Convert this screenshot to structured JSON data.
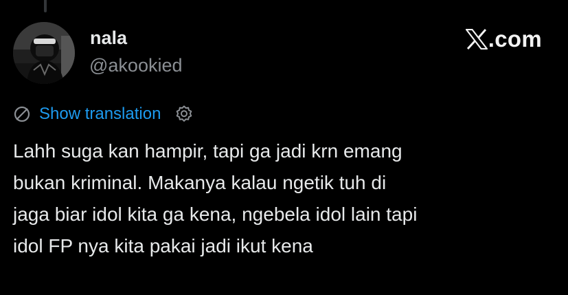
{
  "author": {
    "display_name": "nala",
    "handle": "@akookied",
    "avatar_icon": "profile-photo"
  },
  "brand": {
    "logo_icon": "x-logo-icon",
    "label": ".com"
  },
  "translation": {
    "label": "Show translation",
    "icon": "translate-icon",
    "settings_icon": "gear-icon"
  },
  "tweet": {
    "lines": [
      "Lahh suga kan hampir, tapi ga jadi krn emang",
      "bukan kriminal. Makanya kalau ngetik tuh di",
      "jaga biar idol kita ga kena, ngebela idol lain tapi",
      "idol FP nya kita pakai jadi ikut kena"
    ]
  },
  "colors": {
    "background": "#000000",
    "text_primary": "#e7e9ea",
    "text_secondary": "#8b8f94",
    "accent_link": "#1d9bf0"
  }
}
